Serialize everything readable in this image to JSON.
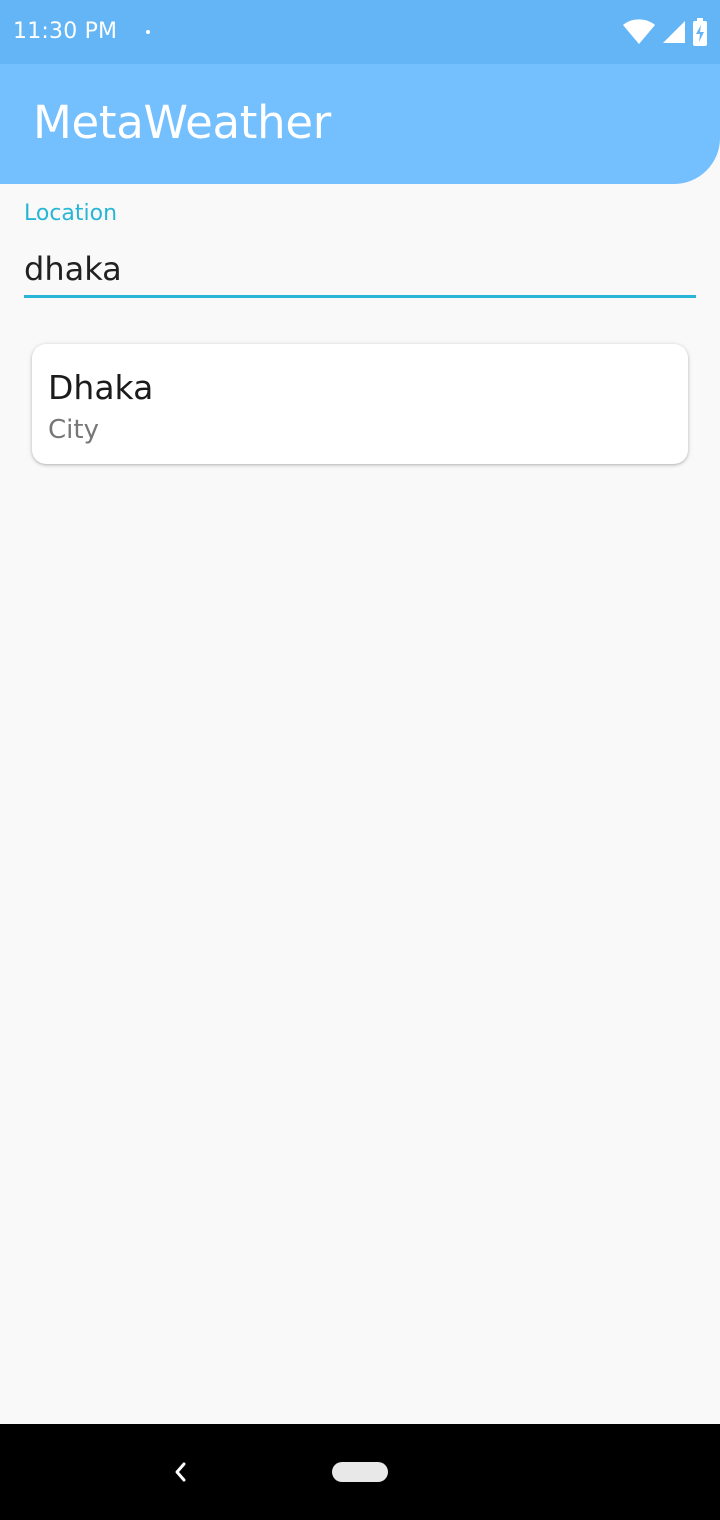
{
  "status_bar": {
    "time": "11:30 PM",
    "icons": [
      "notification-dot-icon",
      "wifi-icon",
      "cell-signal-icon",
      "battery-charging-icon"
    ]
  },
  "app_bar": {
    "title": "MetaWeather",
    "color": "#74bffe"
  },
  "search": {
    "label": "Location",
    "value": "dhaka",
    "accent_color": "#29b6d6"
  },
  "results": [
    {
      "name": "Dhaka",
      "type": "City"
    }
  ],
  "nav_bar": {
    "icons": [
      "back-icon",
      "home-pill-icon"
    ]
  }
}
